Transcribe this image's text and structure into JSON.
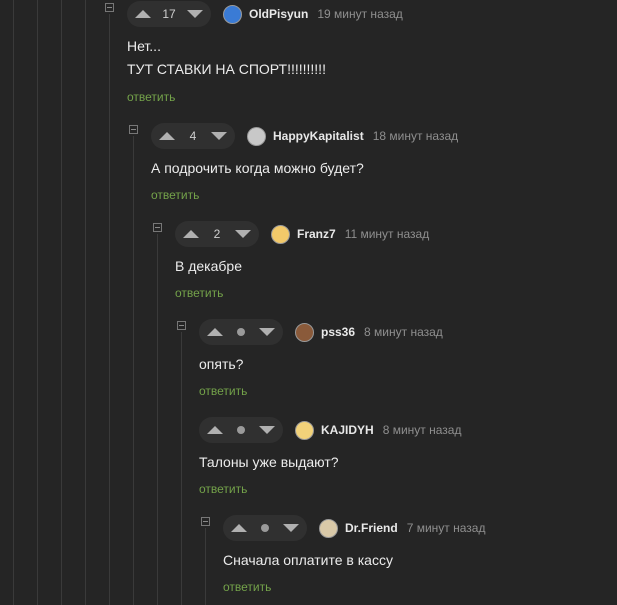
{
  "comments": [
    {
      "score": "17",
      "user": "OldPisyun",
      "time": "19 минут назад",
      "lines": [
        "Нет...",
        "ТУТ СТАВКИ НА СПОРТ!!!!!!!!!!"
      ],
      "reply": "ответить",
      "avatar_color": "#3a7bd5"
    },
    {
      "score": "4",
      "user": "HappyKapitalist",
      "time": "18 минут назад",
      "lines": [
        "А подрочить когда можно будет?"
      ],
      "reply": "ответить",
      "avatar_color": "#c8c8c8"
    },
    {
      "score": "2",
      "user": "Franz7",
      "time": "11 минут назад",
      "lines": [
        "В декабре"
      ],
      "reply": "ответить",
      "avatar_color": "#f2c96a"
    },
    {
      "score": "",
      "user": "pss36",
      "time": "8 минут назад",
      "lines": [
        "опять?"
      ],
      "reply": "ответить",
      "avatar_color": "#8a5a3a"
    },
    {
      "score": "",
      "user": "KAJIDYH",
      "time": "8 минут назад",
      "lines": [
        "Талоны уже выдают?"
      ],
      "reply": "ответить",
      "avatar_color": "#f2d27a"
    },
    {
      "score": "",
      "user": "Dr.Friend",
      "time": "7 минут назад",
      "lines": [
        "Сначала оплатите в кассу"
      ],
      "reply": "ответить",
      "avatar_color": "#d9c9a8"
    }
  ]
}
